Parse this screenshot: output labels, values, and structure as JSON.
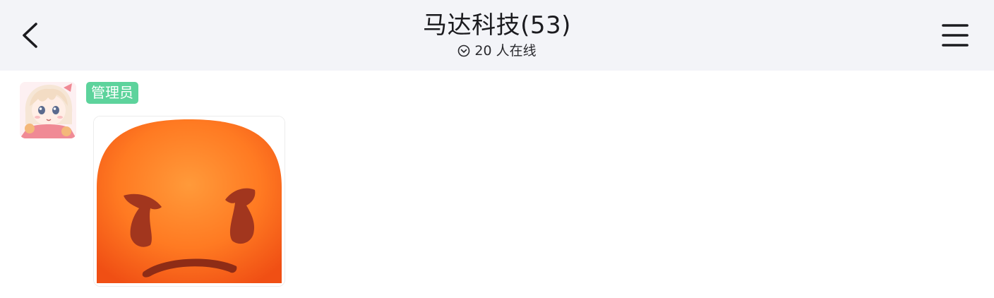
{
  "header": {
    "back_icon": "chevron-left-icon",
    "title": "马达科技(53)",
    "subtitle_icon": "circle-chevron-down-icon",
    "online_count": "20 人在线",
    "menu_icon": "hamburger-menu-icon",
    "background": "#f3f4f8"
  },
  "message": {
    "avatar": "anime-girl-avatar",
    "role_badge": "管理员",
    "role_badge_color": "#5dd39c",
    "content_type": "sticker",
    "sticker": "angry-face-emoji-sticker"
  }
}
